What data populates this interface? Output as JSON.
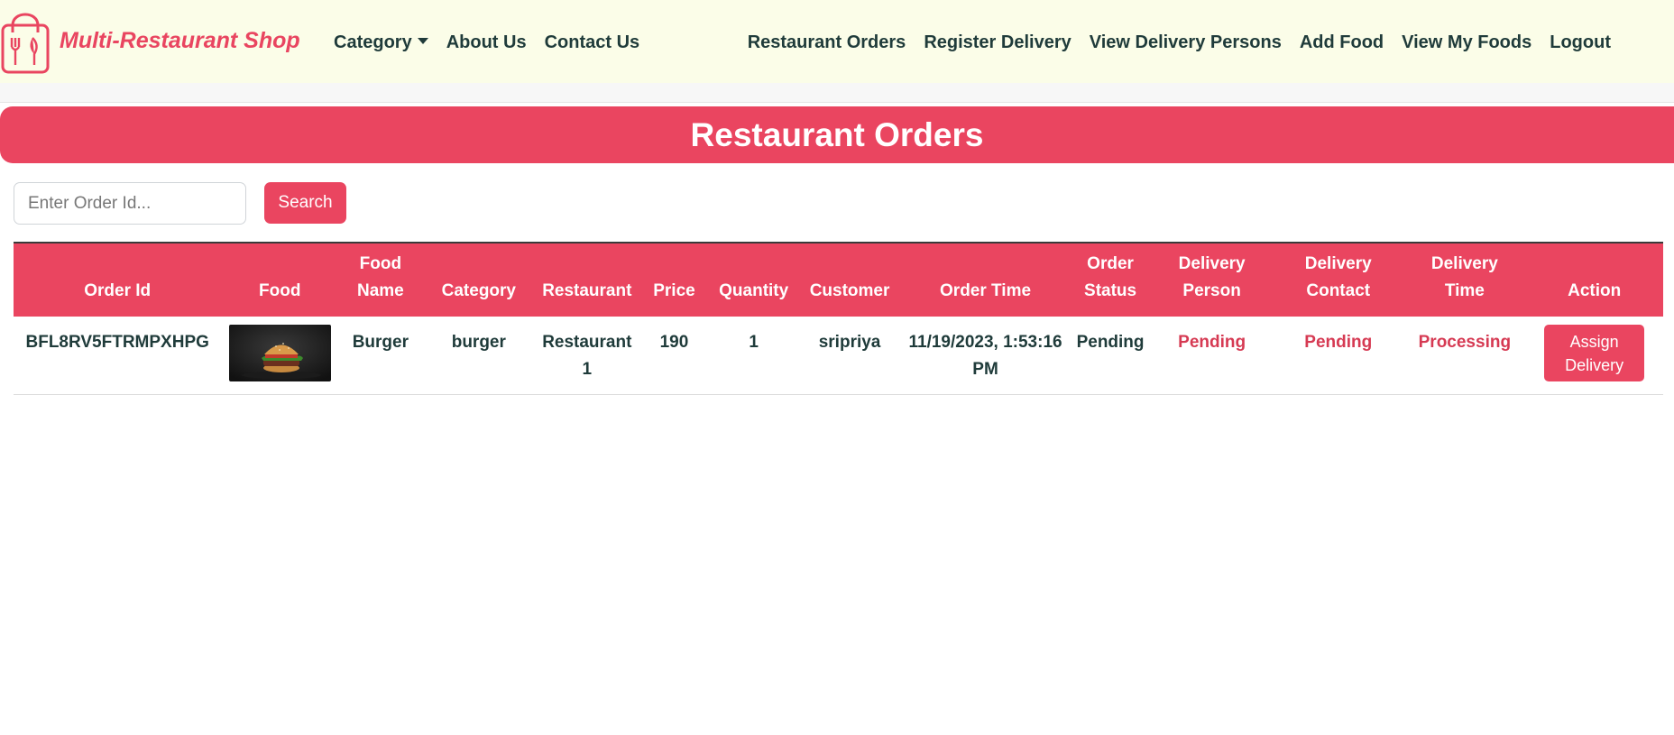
{
  "brand": {
    "name": "Multi-Restaurant Shop",
    "logo_icon": "shopping-bag-fork-knife-icon",
    "color": "#e94560"
  },
  "nav": {
    "left": [
      {
        "label": "Category",
        "has_dropdown": true
      },
      {
        "label": "About Us"
      },
      {
        "label": "Contact Us"
      }
    ],
    "right": [
      {
        "label": "Restaurant Orders"
      },
      {
        "label": "Register Delivery"
      },
      {
        "label": "View Delivery Persons"
      },
      {
        "label": "Add Food"
      },
      {
        "label": "View My Foods"
      },
      {
        "label": "Logout"
      }
    ]
  },
  "page": {
    "title": "Restaurant Orders"
  },
  "search": {
    "placeholder": "Enter Order Id...",
    "value": "",
    "button_label": "Search"
  },
  "table": {
    "headers": [
      [
        "Order Id"
      ],
      [
        "Food"
      ],
      [
        "Food",
        "Name"
      ],
      [
        "Category"
      ],
      [
        "Restaurant"
      ],
      [
        "Price"
      ],
      [
        "Quantity"
      ],
      [
        "Customer"
      ],
      [
        "Order Time"
      ],
      [
        "Order",
        "Status"
      ],
      [
        "Delivery",
        "Person"
      ],
      [
        "Delivery",
        "Contact"
      ],
      [
        "Delivery",
        "Time"
      ],
      [
        "Action"
      ]
    ],
    "rows": [
      {
        "order_id": "BFL8RV5FTRMPXHPG",
        "food_image": "burger-image",
        "food_name": "Burger",
        "category": "burger",
        "restaurant": "Restaurant 1",
        "price": "190",
        "quantity": "1",
        "customer": "sripriya",
        "order_time": "11/19/2023, 1:53:16 PM",
        "order_status": "Pending",
        "delivery_person": "Pending",
        "delivery_contact": "Pending",
        "delivery_time": "Processing",
        "action_label": "Assign Delivery"
      }
    ]
  },
  "colors": {
    "accent": "#ea4560",
    "navbar_bg": "#fbfde8",
    "text": "#1f3b3a",
    "status_red": "#d63a53"
  }
}
